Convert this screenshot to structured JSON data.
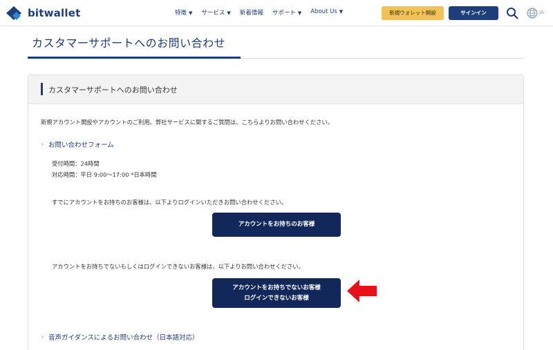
{
  "header": {
    "brand": "bitwallet",
    "nav": [
      {
        "label": "特徴",
        "caret": "▼"
      },
      {
        "label": "サービス",
        "caret": "▼"
      },
      {
        "label": "新着情報",
        "caret": ""
      },
      {
        "label": "サポート",
        "caret": "▼"
      },
      {
        "label": "About Us",
        "caret": "▼"
      }
    ],
    "new_wallet_label": "新規ウォレット開設",
    "signin_label": "サインイン",
    "lang": "JA"
  },
  "page": {
    "title": "カスタマーサポートへのお問い合わせ"
  },
  "card": {
    "header": "カスタマーサポートへのお問い合わせ",
    "intro": "新規アカウント開設やアカウントのご利用、弊社サービスに関するご質問は、こちらよりお問い合わせください。",
    "form_link": "お問い合わせフォーム",
    "hours_line1": "受付時間：24時間",
    "hours_line2": "対応時間：平日 9:00～17:00 *日本時間",
    "account_holder_text": "すでにアカウントをお持ちのお客様は、以下よりログインいただきお問い合わせください。",
    "account_holder_button": "アカウントをお持ちのお客様",
    "no_account_text": "アカウントをお持ちでないもしくはログインできないお客様は、以下よりお問い合わせください。",
    "no_account_button_line1": "アカウントをお持ちでないお客様",
    "no_account_button_line2": "ログインできないお客様",
    "voice_link": "音声ガイダンスによるお問い合わせ（日本語対応）"
  },
  "colors": {
    "brand_blue": "#1e3c78",
    "button_dark": "#13285a",
    "new_wallet_yellow": "#f0c35a",
    "annotation_red": "#e8101a"
  }
}
